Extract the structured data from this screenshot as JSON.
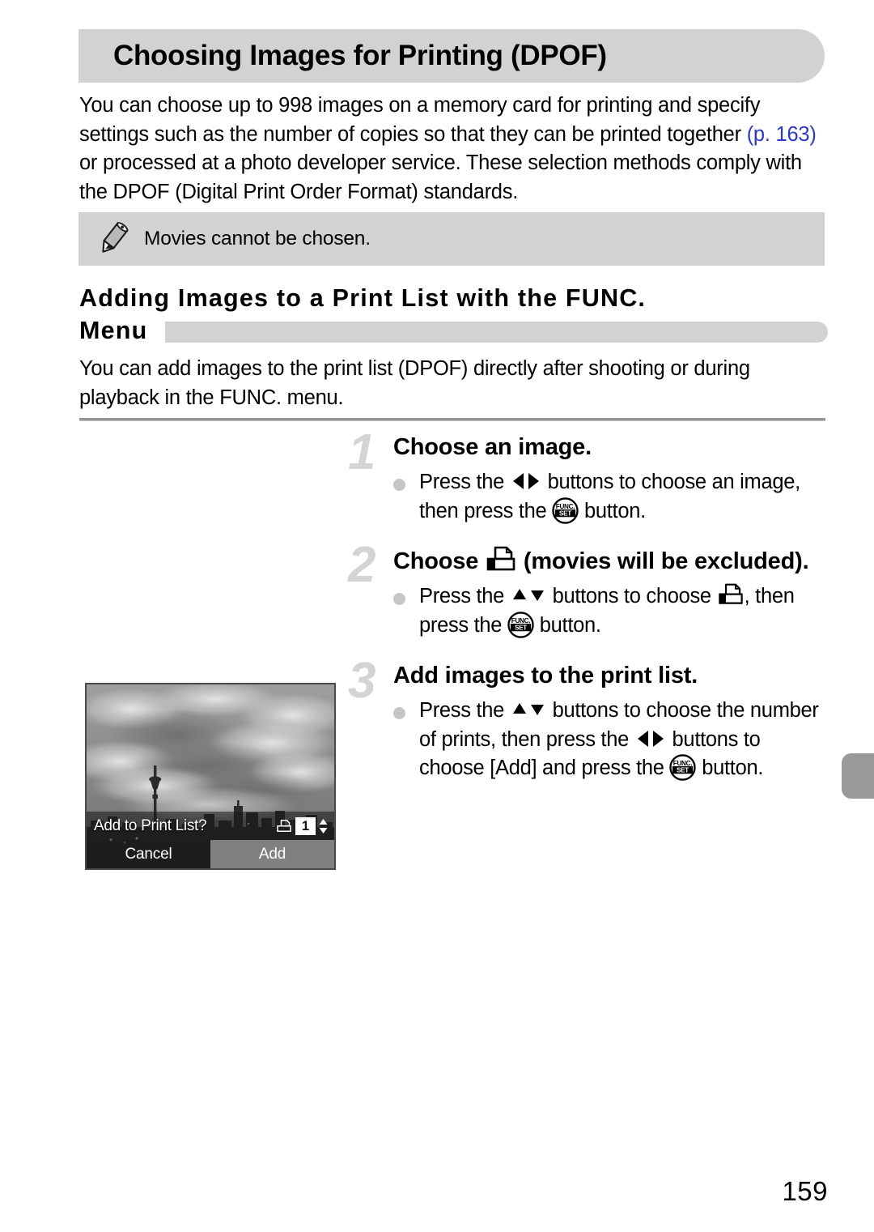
{
  "page": {
    "title": "Choosing Images for Printing (DPOF)",
    "number": "159"
  },
  "intro": {
    "part1": "You can choose up to 998 images on a memory card for printing and specify settings such as the number of copies so that they can be printed together ",
    "page_ref": "(p. 163)",
    "page_ref_color": "#2b39c8",
    "part2": " or processed at a photo developer service. These selection methods comply with the DPOF (Digital Print Order Format) standards."
  },
  "note": {
    "icon": "pencil-icon",
    "text": "Movies cannot be chosen."
  },
  "section": {
    "line1": "Adding Images to a Print List with the FUNC.",
    "line2": "Menu",
    "paragraph": "You can add images to the print list (DPOF) directly after shooting or during playback in the FUNC. menu."
  },
  "steps": [
    {
      "number": "1",
      "title_before": "Choose an image.",
      "title_after": "",
      "body": [
        {
          "text": "Press the "
        },
        {
          "icon": "left-right-arrows-icon"
        },
        {
          "text": " buttons to choose an image, then press the "
        },
        {
          "icon": "func-set-button-icon"
        },
        {
          "text": " button."
        }
      ]
    },
    {
      "number": "2",
      "title_before": "Choose ",
      "title_icon": "dpof-print-icon",
      "title_after": " (movies will be excluded).",
      "body": [
        {
          "text": "Press the "
        },
        {
          "icon": "up-down-arrows-icon"
        },
        {
          "text": " buttons to choose "
        },
        {
          "icon": "dpof-print-icon"
        },
        {
          "text": ", then press the "
        },
        {
          "icon": "func-set-button-icon"
        },
        {
          "text": " button."
        }
      ]
    },
    {
      "number": "3",
      "title_before": "Add images to the print list.",
      "title_after": "",
      "body": [
        {
          "text": "Press the "
        },
        {
          "icon": "up-down-arrows-icon"
        },
        {
          "text": " buttons to choose the number of prints, then press the "
        },
        {
          "icon": "left-right-arrows-icon"
        },
        {
          "text": " buttons to choose [Add] and press the "
        },
        {
          "icon": "func-set-button-icon"
        },
        {
          "text": " button."
        }
      ]
    }
  ],
  "camera_screen": {
    "scene": "city skyline with tower under cloudy sky",
    "prompt": "Add to Print List?",
    "print_icon": "dpof-print-icon",
    "count": "1",
    "spinner": "up-down-spinner-icon",
    "cancel_label": "Cancel",
    "add_label": "Add",
    "selected_button": "Add"
  },
  "colors": {
    "bar_gray": "#d2d2d2",
    "step_number_gray": "#d4d4d4",
    "thumb_tab_gray": "#999999",
    "link_blue": "#2b39c8"
  }
}
